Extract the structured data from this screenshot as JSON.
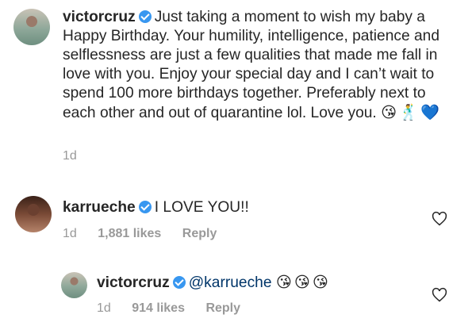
{
  "post": {
    "username": "victorcruz",
    "caption": "Just taking a moment to wish my baby a Happy Birthday. Your humility, intelligence, patience and selflessness are just a few qualities that made me fall in love with you. Enjoy your special day and I can’t wait to spend 100 more birthdays together. Preferably next to each other and out of quarantine lol. Love you.",
    "emojis": [
      "😘",
      "🕺",
      "💙"
    ],
    "time": "1d"
  },
  "comments": [
    {
      "username": "karrueche",
      "text": "I LOVE YOU!!",
      "time": "1d",
      "likes": "1,881 likes",
      "reply_label": "Reply"
    },
    {
      "username": "victorcruz",
      "mention": "@karrueche",
      "emojis": [
        "😘",
        "😘",
        "😘"
      ],
      "time": "1d",
      "likes": "914 likes",
      "reply_label": "Reply"
    }
  ],
  "colors": {
    "verified": "#3897f0",
    "mention": "#003569",
    "meta": "#999999"
  }
}
